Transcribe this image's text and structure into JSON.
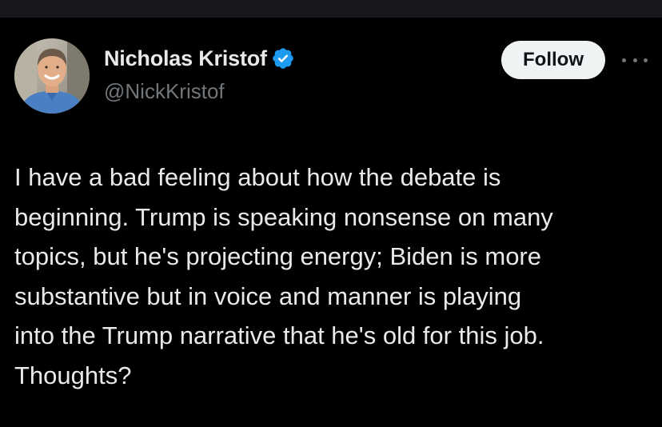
{
  "author": {
    "display_name": "Nicholas Kristof",
    "handle": "@NickKristof",
    "verified": true,
    "verified_color": "#1d9bf0"
  },
  "actions": {
    "follow_label": "Follow",
    "more_icon": "more-horizontal-icon"
  },
  "tweet": {
    "text": "I have a bad feeling about how the debate is\nbeginning. Trump is speaking nonsense on many\ntopics, but he's projecting energy; Biden is more\nsubstantive but in voice and manner is playing\ninto the Trump narrative that he's old for this job.\nThoughts?"
  },
  "colors": {
    "background": "#000000",
    "text_primary": "#e7e9ea",
    "text_secondary": "#71767b",
    "button_bg": "#eff3f4",
    "button_text": "#0f1419"
  }
}
